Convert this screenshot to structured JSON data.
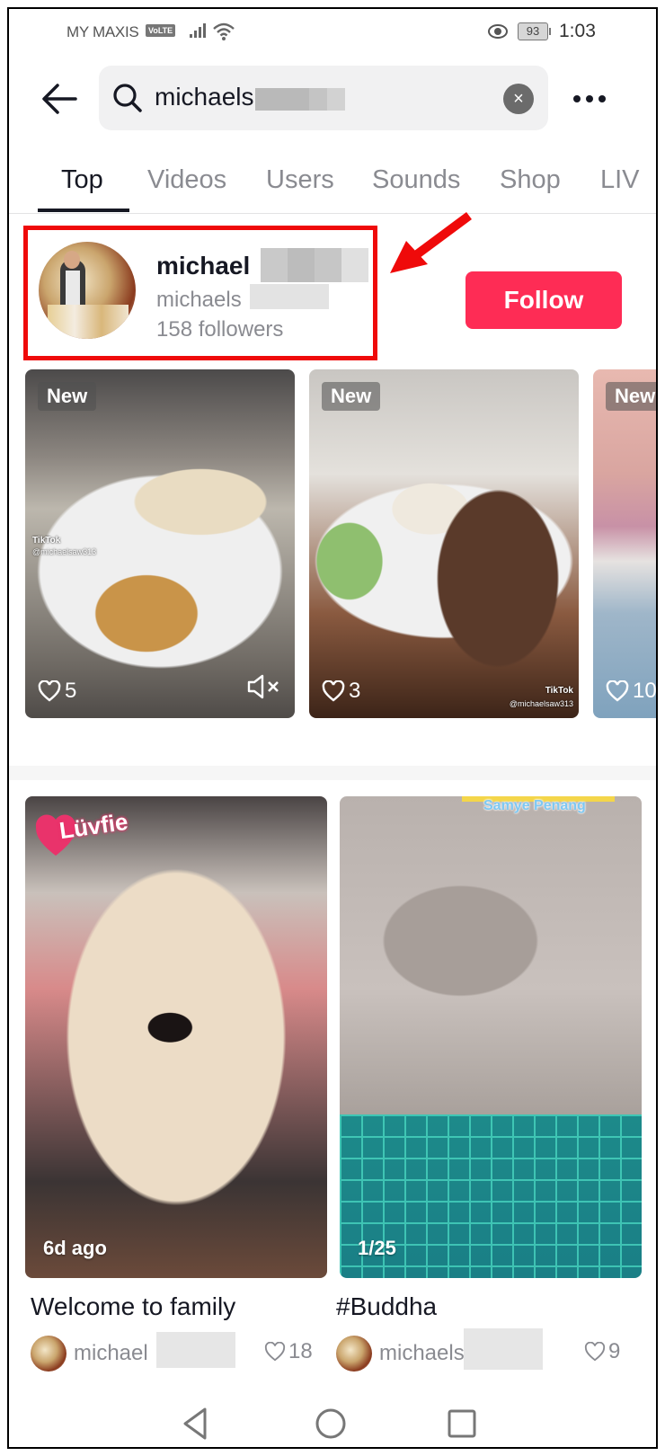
{
  "status_bar": {
    "carrier": "MY MAXIS",
    "volte_badge": "VoLTE",
    "battery": "93",
    "time": "1:03"
  },
  "search": {
    "query": "michaels",
    "clear_label": "×"
  },
  "tabs": [
    {
      "label": "Top",
      "active": true
    },
    {
      "label": "Videos",
      "active": false
    },
    {
      "label": "Users",
      "active": false
    },
    {
      "label": "Sounds",
      "active": false
    },
    {
      "label": "Shop",
      "active": false
    },
    {
      "label": "LIV",
      "active": false
    }
  ],
  "user_result": {
    "name": "michael",
    "handle": "michaels",
    "followers": "158 followers",
    "follow_label": "Follow",
    "highlight_color": "#ef0a0a",
    "follow_color": "#fe2c55"
  },
  "video_row": [
    {
      "badge": "New",
      "likes": "5",
      "muted": true,
      "watermark": "TikTok",
      "watermark_user": "@michaelsaw313"
    },
    {
      "badge": "New",
      "likes": "3",
      "muted": false,
      "watermark": "TikTok",
      "watermark_user": "@michaelsaw313"
    },
    {
      "badge": "New",
      "likes": "10"
    }
  ],
  "cards": [
    {
      "overlay_sticker": "Lüvfie",
      "meta": "6d ago",
      "title": "Welcome to family",
      "author": "michael",
      "likes": "18"
    },
    {
      "overlay_sticker": "Samye Penang",
      "meta": "1/25",
      "title": "#Buddha",
      "author": "michaels",
      "likes": "9"
    }
  ],
  "nav": {
    "back": "back-triangle",
    "home": "home-circle",
    "recents": "recents-square"
  }
}
